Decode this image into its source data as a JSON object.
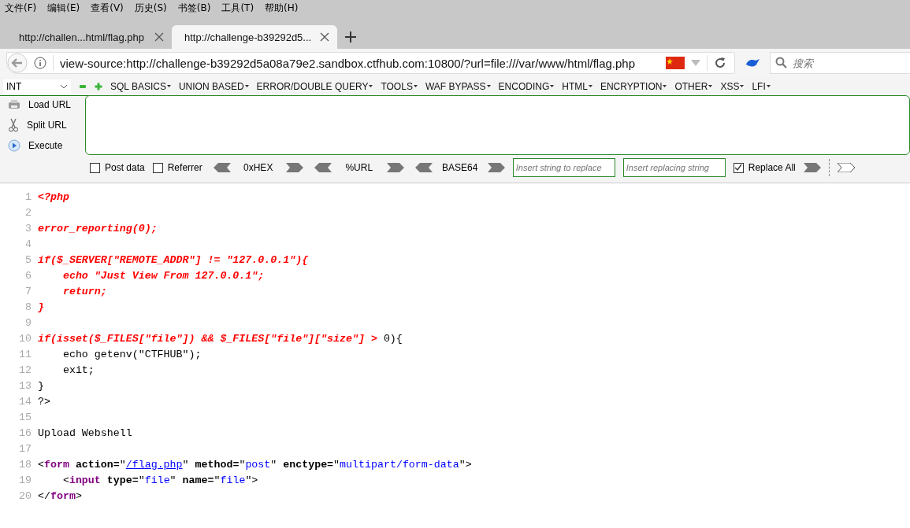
{
  "menu_bar": [
    "文件(F)",
    "编辑(E)",
    "查看(V)",
    "历史(S)",
    "书签(B)",
    "工具(T)",
    "帮助(H)"
  ],
  "tabs": [
    {
      "title": "http://challen...html/flag.php",
      "selected": false
    },
    {
      "title": "http://challenge-b39292d5...",
      "selected": true
    }
  ],
  "address_bar": {
    "url": "view-source:http://challenge-b39292d5a08a79e2.sandbox.ctfhub.com:10800/?url=file:///var/www/html/flag.php"
  },
  "search": {
    "placeholder": "搜索"
  },
  "hackbar": {
    "type_select": "INT",
    "menus": [
      "SQL BASICS",
      "UNION BASED",
      "ERROR/DOUBLE QUERY",
      "TOOLS",
      "WAF BYPASS",
      "ENCODING",
      "HTML",
      "ENCRYPTION",
      "OTHER",
      "XSS",
      "LFI"
    ],
    "actions": [
      {
        "kind": "load",
        "label": "Load URL"
      },
      {
        "kind": "split",
        "label": "Split URL"
      },
      {
        "kind": "execute",
        "label": "Execute"
      }
    ],
    "options": [
      {
        "label": "Post data",
        "checked": false
      },
      {
        "label": "Referrer",
        "checked": false
      }
    ],
    "encoders": [
      "0xHEX",
      "%URL",
      "BASE64"
    ],
    "replace_fields": [
      {
        "placeholder": "Insert string to replace"
      },
      {
        "placeholder": "Insert replacing string"
      }
    ],
    "replace_all": {
      "label": "Replace All",
      "checked": true
    }
  },
  "source_lines": [
    {
      "number": "1",
      "tokens": [
        {
          "kind": "php",
          "text": "<?php"
        }
      ]
    },
    {
      "number": "2"
    },
    {
      "number": "3",
      "tokens": [
        {
          "kind": "php",
          "text": "error_reporting(0);"
        }
      ]
    },
    {
      "number": "4"
    },
    {
      "number": "5",
      "tokens": [
        {
          "kind": "php",
          "text": "if($_SERVER[\"REMOTE_ADDR\"] != \"127.0.0.1\"){"
        }
      ]
    },
    {
      "number": "6",
      "tokens": [
        {
          "kind": "php",
          "text": "    echo \"Just View From 127.0.0.1\";"
        }
      ]
    },
    {
      "number": "7",
      "tokens": [
        {
          "kind": "php",
          "text": "    return;"
        }
      ]
    },
    {
      "number": "8",
      "tokens": [
        {
          "kind": "php",
          "text": "}"
        }
      ]
    },
    {
      "number": "9"
    },
    {
      "number": "10",
      "tokens": [
        {
          "kind": "php",
          "text": "if(isset($_FILES[\"file\"]) && $_FILES[\"file\"][\"size\"] > "
        },
        {
          "kind": "text",
          "text": "0){"
        }
      ]
    },
    {
      "number": "11",
      "tokens": [
        {
          "kind": "text",
          "text": "    echo getenv(\"CTFHUB\");"
        }
      ]
    },
    {
      "number": "12",
      "tokens": [
        {
          "kind": "text",
          "text": "    exit;"
        }
      ]
    },
    {
      "number": "13",
      "tokens": [
        {
          "kind": "text",
          "text": "}"
        }
      ]
    },
    {
      "number": "14",
      "tokens": [
        {
          "kind": "text",
          "text": "?>"
        }
      ]
    },
    {
      "number": "15"
    },
    {
      "number": "16",
      "tokens": [
        {
          "kind": "text",
          "text": "Upload Webshell"
        }
      ]
    },
    {
      "number": "17"
    },
    {
      "number": "18",
      "tokens": [
        {
          "kind": "text",
          "text": "<"
        },
        {
          "kind": "tag",
          "text": "form"
        },
        {
          "kind": "attr",
          "text": " action="
        },
        {
          "kind": "text",
          "text": "\""
        },
        {
          "kind": "link",
          "text": "/flag.php"
        },
        {
          "kind": "text",
          "text": "\" "
        },
        {
          "kind": "attr",
          "text": "method="
        },
        {
          "kind": "text",
          "text": "\""
        },
        {
          "kind": "value",
          "text": "post"
        },
        {
          "kind": "text",
          "text": "\" "
        },
        {
          "kind": "attr",
          "text": "enctype="
        },
        {
          "kind": "text",
          "text": "\""
        },
        {
          "kind": "value",
          "text": "multipart/form-data"
        },
        {
          "kind": "text",
          "text": "\">"
        }
      ]
    },
    {
      "number": "19",
      "tokens": [
        {
          "kind": "text",
          "text": "    <"
        },
        {
          "kind": "tag",
          "text": "input"
        },
        {
          "kind": "attr",
          "text": " type="
        },
        {
          "kind": "text",
          "text": "\""
        },
        {
          "kind": "value",
          "text": "file"
        },
        {
          "kind": "text",
          "text": "\" "
        },
        {
          "kind": "attr",
          "text": "name="
        },
        {
          "kind": "text",
          "text": "\""
        },
        {
          "kind": "value",
          "text": "file"
        },
        {
          "kind": "text",
          "text": "\">"
        }
      ]
    },
    {
      "number": "20",
      "tokens": [
        {
          "kind": "text",
          "text": "</"
        },
        {
          "kind": "tag",
          "text": "form"
        },
        {
          "kind": "text",
          "text": ">"
        }
      ]
    }
  ]
}
